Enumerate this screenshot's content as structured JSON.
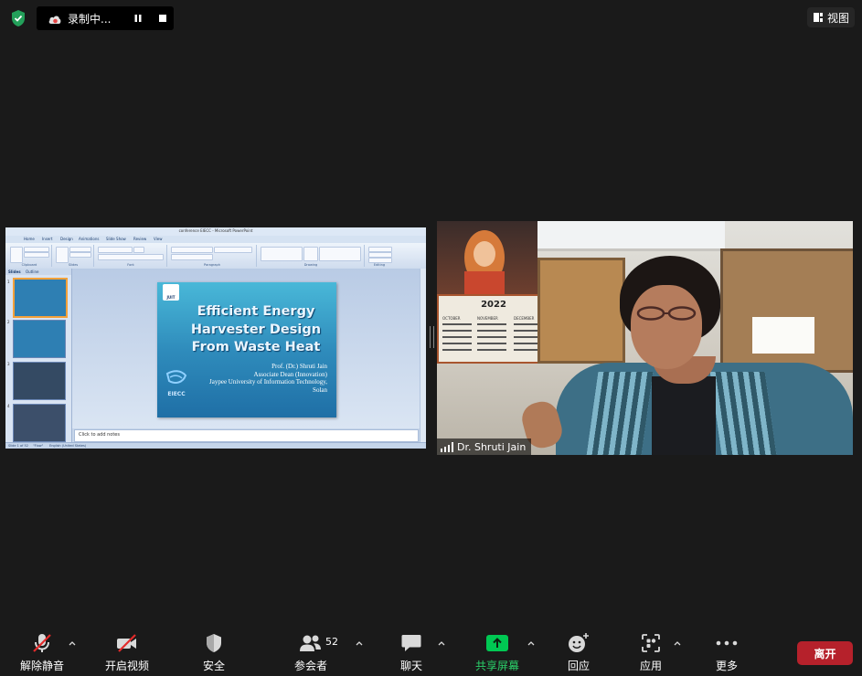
{
  "top_bar": {
    "recording_label": "录制中...",
    "view_label": "视图"
  },
  "shared_screen": {
    "window_title": "conference EIECC - Microsoft PowerPoint",
    "ribbon_tabs": [
      "Home",
      "Insert",
      "Design",
      "Animations",
      "Slide Show",
      "Review",
      "View"
    ],
    "ribbon_groups": [
      "Clipboard",
      "Slides",
      "Font",
      "Paragraph",
      "Drawing",
      "Editing"
    ],
    "left_panel_tabs": [
      "Slides",
      "Outline"
    ],
    "thumbnail_numbers": [
      "1",
      "2",
      "3",
      "4"
    ],
    "slide": {
      "logo_text": "JUIT",
      "title_lines": [
        "Efficient Energy",
        "Harvester Design",
        "From Waste Heat"
      ],
      "author_lines": [
        "Prof. (Dr.) Shruti Jain",
        "Associate Dean (Innovation)",
        "Jaypee University of Information Technology,",
        "Solan"
      ],
      "eiecc_label": "EIECC"
    },
    "notes_placeholder": "Click to add notes",
    "status_items": [
      "Slide 1 of 52",
      "\"Flow\"",
      "English (United States)"
    ]
  },
  "video_tile": {
    "participant_name": "Dr. Shruti Jain",
    "calendar_year": "2022",
    "calendar_months": [
      "OCTOBER",
      "NOVEMBER",
      "DECEMBER"
    ]
  },
  "toolbar": {
    "unmute_label": "解除静音",
    "start_video_label": "开启视频",
    "security_label": "安全",
    "participants_label": "参会者",
    "participants_count": "52",
    "chat_label": "聊天",
    "share_screen_label": "共享屏幕",
    "reactions_label": "回应",
    "apps_label": "应用",
    "more_label": "更多",
    "leave_label": "离开"
  },
  "colors": {
    "background": "#1a1a1a",
    "share_green": "#00c853",
    "leave_red": "#b6212b",
    "security_green": "#23a05a"
  }
}
